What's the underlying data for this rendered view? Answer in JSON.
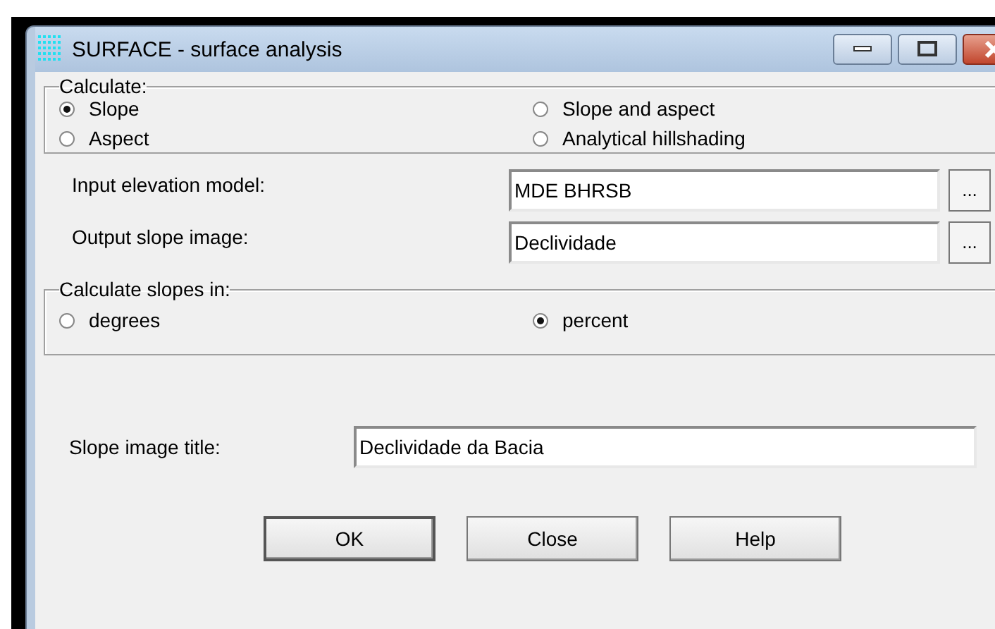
{
  "window": {
    "title": "SURFACE - surface analysis"
  },
  "calculate": {
    "legend": "Calculate:",
    "options": [
      {
        "label": "Slope",
        "selected": true
      },
      {
        "label": "Slope and aspect",
        "selected": false
      },
      {
        "label": "Aspect",
        "selected": false
      },
      {
        "label": "Analytical hillshading",
        "selected": false
      }
    ]
  },
  "files": [
    {
      "label": "Input elevation model:",
      "value": "MDE BHRSB",
      "browse": "..."
    },
    {
      "label": "Output slope image:",
      "value": "Declividade",
      "browse": "..."
    }
  ],
  "units": {
    "legend": "Calculate slopes in:",
    "options": [
      {
        "label": "degrees",
        "selected": false
      },
      {
        "label": "percent",
        "selected": true
      }
    ]
  },
  "title_field": {
    "label": "Slope image title:",
    "value": "Declividade da Bacia"
  },
  "buttons": [
    "OK",
    "Close",
    "Help"
  ]
}
